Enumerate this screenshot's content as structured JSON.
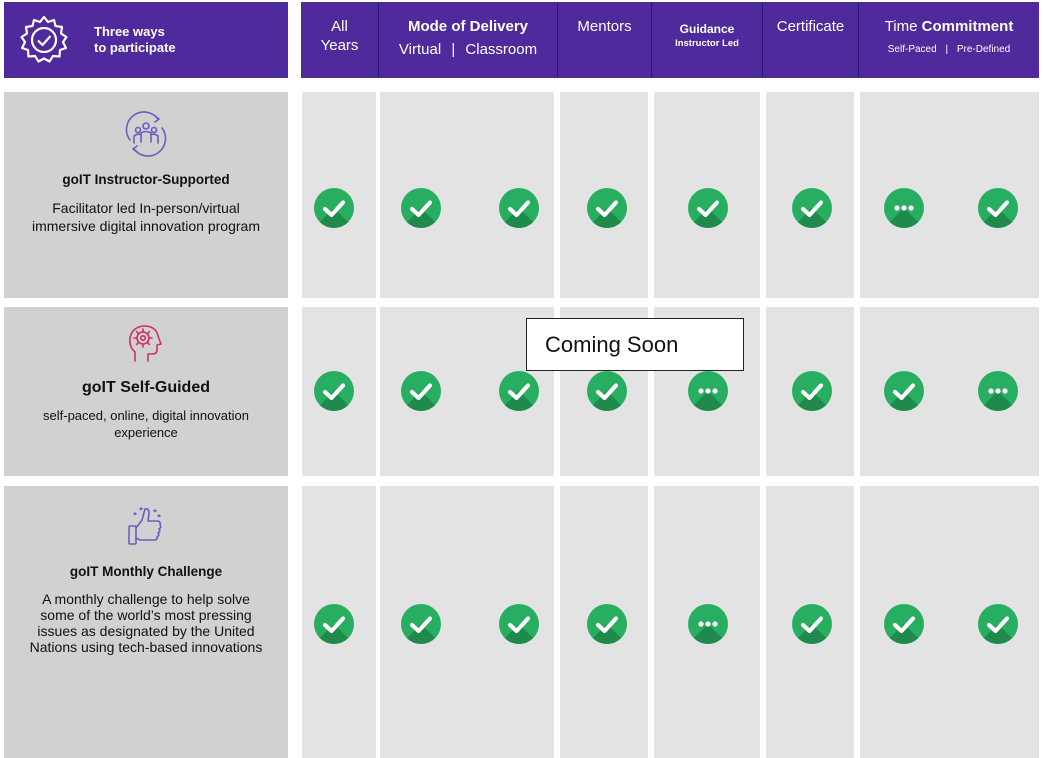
{
  "header": {
    "title_line1": "Three ways",
    "title_line2": "to participate",
    "columns": {
      "all_years": {
        "line1": "All",
        "line2": "Years"
      },
      "delivery": {
        "title": "Mode of Delivery",
        "opt1": "Virtual",
        "opt2": "Classroom"
      },
      "mentors": {
        "title": "Mentors"
      },
      "guidance": {
        "title": "Guidance",
        "sub": "Instructor Led"
      },
      "certificate": {
        "title": "Certificate"
      },
      "time": {
        "title_a": "Time",
        "title_b": "Commitment",
        "opt1": "Self-Paced",
        "opt2": "Pre-Defined"
      }
    },
    "separator": "|"
  },
  "rows": [
    {
      "name": "goIT Instructor-Supported",
      "icon": "team-icon",
      "description": "Facilitator led In-person/virtual immersive digital innovation program",
      "marks": [
        "check",
        "check",
        "check",
        "check",
        "check",
        "check",
        "dots",
        "check"
      ]
    },
    {
      "name": "goIT Self-Guided",
      "icon": "mind-gear-icon",
      "description": "self-paced, online, digital innovation experience",
      "marks": [
        "check",
        "check",
        "check",
        "check",
        "dots",
        "check",
        "check",
        "dots"
      ]
    },
    {
      "name": "goIT Monthly Challenge",
      "icon": "thumbs-up-icon",
      "description": "A monthly challenge to help solve some of the world’s most pressing issues as designated by the United Nations using tech-based innovations",
      "marks": [
        "check",
        "check",
        "check",
        "check",
        "dots",
        "check",
        "check",
        "check"
      ]
    }
  ],
  "overlay": {
    "coming_soon": "Coming Soon"
  },
  "colors": {
    "header": "#4f2a9c",
    "label_bg": "#d1d1d1",
    "cell_bg": "#e3e3e3",
    "mark_green": "#27ae60",
    "icon_purple": "#6a5fbf",
    "icon_red": "#d22f5f"
  }
}
